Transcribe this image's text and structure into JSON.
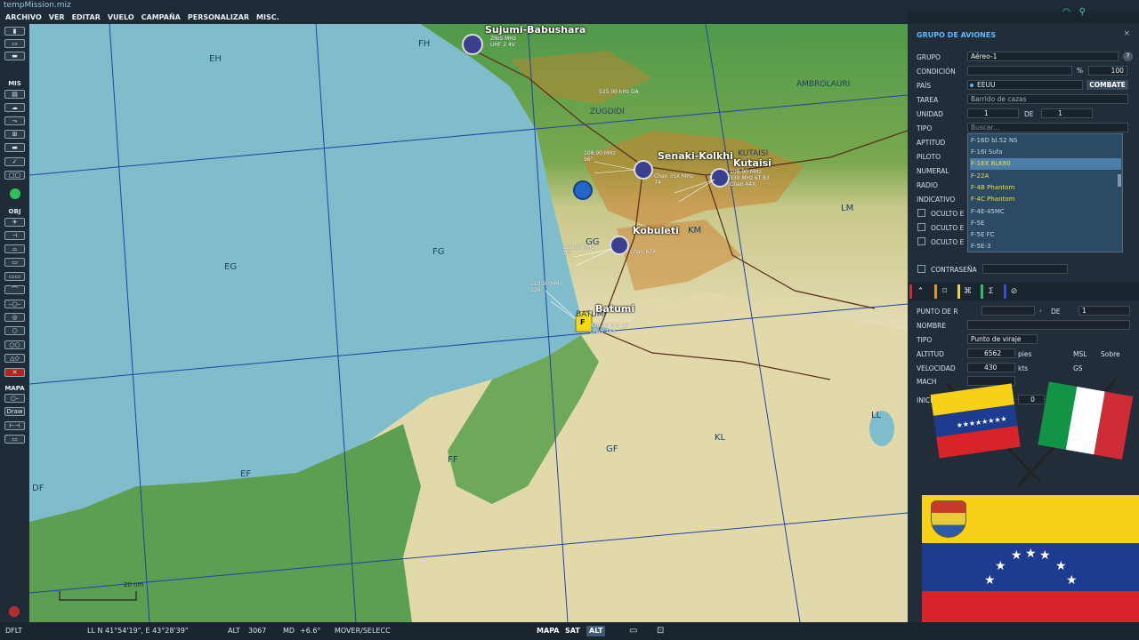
{
  "window": {
    "title": "tempMission.miz"
  },
  "menu": [
    "ARCHIVO",
    "VER",
    "EDITAR",
    "VUELO",
    "CAMPAÑA",
    "PERSONALIZAR",
    "MISC."
  ],
  "toolbar": {
    "mis_label": "MIS",
    "obj_label": "OBJ",
    "mapa_label": "MAPA",
    "draw_label": "Draw"
  },
  "map": {
    "grid_labels": [
      "FH",
      "EH",
      "EG",
      "FG",
      "GG",
      "KM",
      "LM",
      "EF",
      "FF",
      "GF",
      "KL",
      "LL",
      "DF"
    ],
    "regions": [
      "AMBROLAURI",
      "ZUGDIDI",
      "KUTAISI",
      "BATUMI"
    ],
    "airbases": [
      "Sujumi-Babushara",
      "Senaki-Kolkhi",
      "Kutaisi",
      "Kobuleti",
      "Batumi"
    ],
    "freqs": {
      "sujumi": "ZNIS MHz\nUHF 2 4V",
      "zugdidi": "525.00 kHz DA",
      "senaki": "108.90 MHz\n96°",
      "senaki2": "Chan 31X MHz\n74",
      "kutaisi": "108.90 MHz\n330 MHz KT 83\nChan 44X",
      "kobuleti": "111.50 MHz\n70°",
      "kobuleti2": "Chan 67X",
      "batumi": "110.30 MHz\n126°",
      "batumi2": "430.00 kHz LU\nChan 16X"
    },
    "scale_label": "20 nm",
    "flight_marker": "F"
  },
  "status": {
    "profile": "DFLT",
    "coords": "LL  N 41°54'19\", E 43°28'39\"",
    "alt_label": "ALT",
    "alt_value": "3067",
    "md_label": "MD",
    "md_value": "+6.6°",
    "mode": "MOVER/SELECC",
    "map_btn": "MAPA",
    "sat_btn": "SAT",
    "alt_btn": "ALT"
  },
  "panel": {
    "title": "GRUPO DE AVIONES",
    "grupo_label": "GRUPO",
    "grupo_value": "Aéreo-1",
    "condicion_label": "CONDICIÓN",
    "condicion_pct": "%",
    "condicion_value": "100",
    "pais_label": "PAÍS",
    "pais_value": "EEUU",
    "combate_btn": "COMBATE",
    "tarea_label": "TAREA",
    "tarea_value": "Barrido de cazas",
    "unidad_label": "UNIDAD",
    "unidad_value": "1",
    "de_label": "DE",
    "de_value": "1",
    "tipo_label": "TIPO",
    "tipo_placeholder": "Buscar...",
    "aptitud_label": "APTITUD",
    "piloto_label": "PILOTO",
    "numeral_label": "NUMERAL",
    "radio_label": "RADIO",
    "indicativo_label": "INDICATIVO",
    "oculto1": "OCULTO E",
    "oculto2": "OCULTO E",
    "oculto3": "OCULTO E",
    "contrasena_label": "CONTRASEÑA",
    "aircraft_options": [
      "F-16D bl.52 NS",
      "F-16I Sufa",
      "F-16X BLK80",
      "F-22A",
      "F-4B Phantom",
      "F-4C Phantom",
      "F-4E-45MC",
      "F-5E",
      "F-5E FC",
      "F-5E-3"
    ],
    "selected_option": "F-16X BLK80",
    "wp": {
      "punto_label": "PUNTO DE R",
      "de_label": "DE",
      "de_value": "1",
      "nombre_label": "NOMBRE",
      "tipo_label": "TIPO",
      "tipo_value": "Punto de viraje",
      "altitud_label": "ALTITUD",
      "altitud_value": "6562",
      "altitud_unit": "pies",
      "msl": "MSL",
      "sobre": "Sobre",
      "velocidad_label": "VELOCIDAD",
      "velocidad_value": "430",
      "velocidad_unit": "kts",
      "gs": "GS",
      "mach_label": "MACH",
      "inicio_label": "INICIO",
      "inicio_value": "0"
    }
  },
  "colors": {
    "ve_yellow": "#f7d117",
    "ve_blue": "#1d3b8f",
    "ve_red": "#d8232a",
    "it_green": "#129447",
    "it_red": "#cf2b37",
    "accent": "#5fb8ff"
  }
}
